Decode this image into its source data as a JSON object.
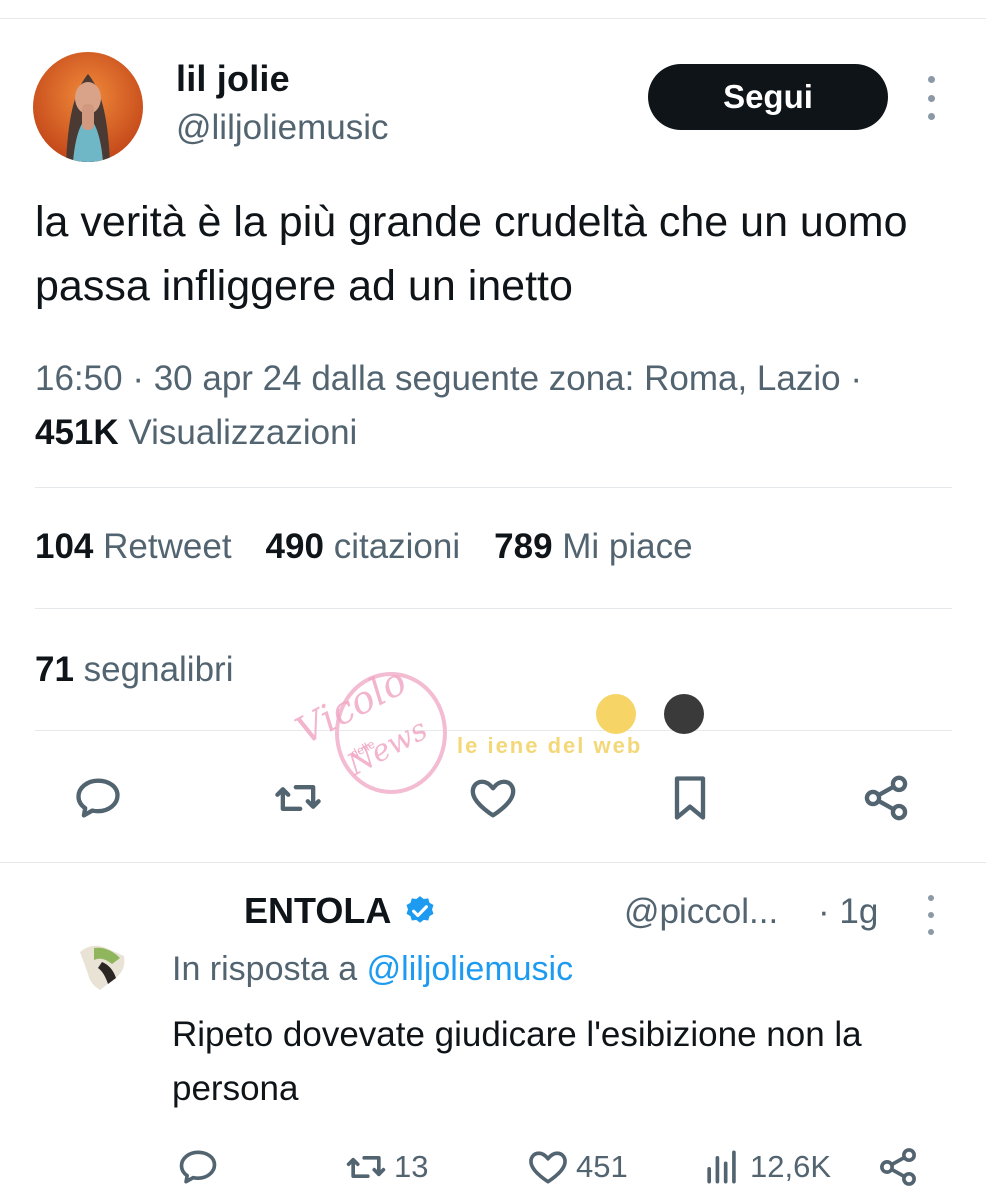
{
  "tweet": {
    "author": {
      "display_name": "lil jolie",
      "handle": "@liljoliemusic",
      "avatar_icon": "profile-photo"
    },
    "follow_label": "Segui",
    "text": "la verità è la più grande crudeltà che un uomo passa infliggere ad un inetto",
    "meta": {
      "time": "16:50",
      "date": "30 apr 24",
      "location_text": "dalla seguente zona: Roma, Lazio",
      "views_count": "451K",
      "views_label": "Visualizzazioni"
    },
    "stats": {
      "retweets_count": "104",
      "retweets_label": "Retweet",
      "quotes_count": "490",
      "quotes_label": "citazioni",
      "likes_count": "789",
      "likes_label": "Mi piace",
      "bookmarks_count": "71",
      "bookmarks_label": "segnalibri"
    },
    "actions": [
      "reply-icon",
      "retweet-icon",
      "like-icon",
      "bookmark-icon",
      "share-icon"
    ]
  },
  "watermark": {
    "left_text": "Vicolo",
    "left_small": "delle",
    "left_text2": "News",
    "right_text": "le iene del web"
  },
  "reply": {
    "display_name": "ENTOLA",
    "handle": "@piccol...",
    "time": "· 1g",
    "in_reply_prefix": "In risposta a",
    "in_reply_mention": "@liljoliemusic",
    "text": "Ripeto dovevate giudicare l'esibizione non la persona",
    "retweets": "13",
    "likes": "451",
    "views": "12,6K"
  },
  "colors": {
    "text": "#0f1419",
    "secondary": "#536471",
    "link": "#1d9bf0",
    "divider": "#e6e9ec",
    "verified": "#1d9bf0"
  }
}
